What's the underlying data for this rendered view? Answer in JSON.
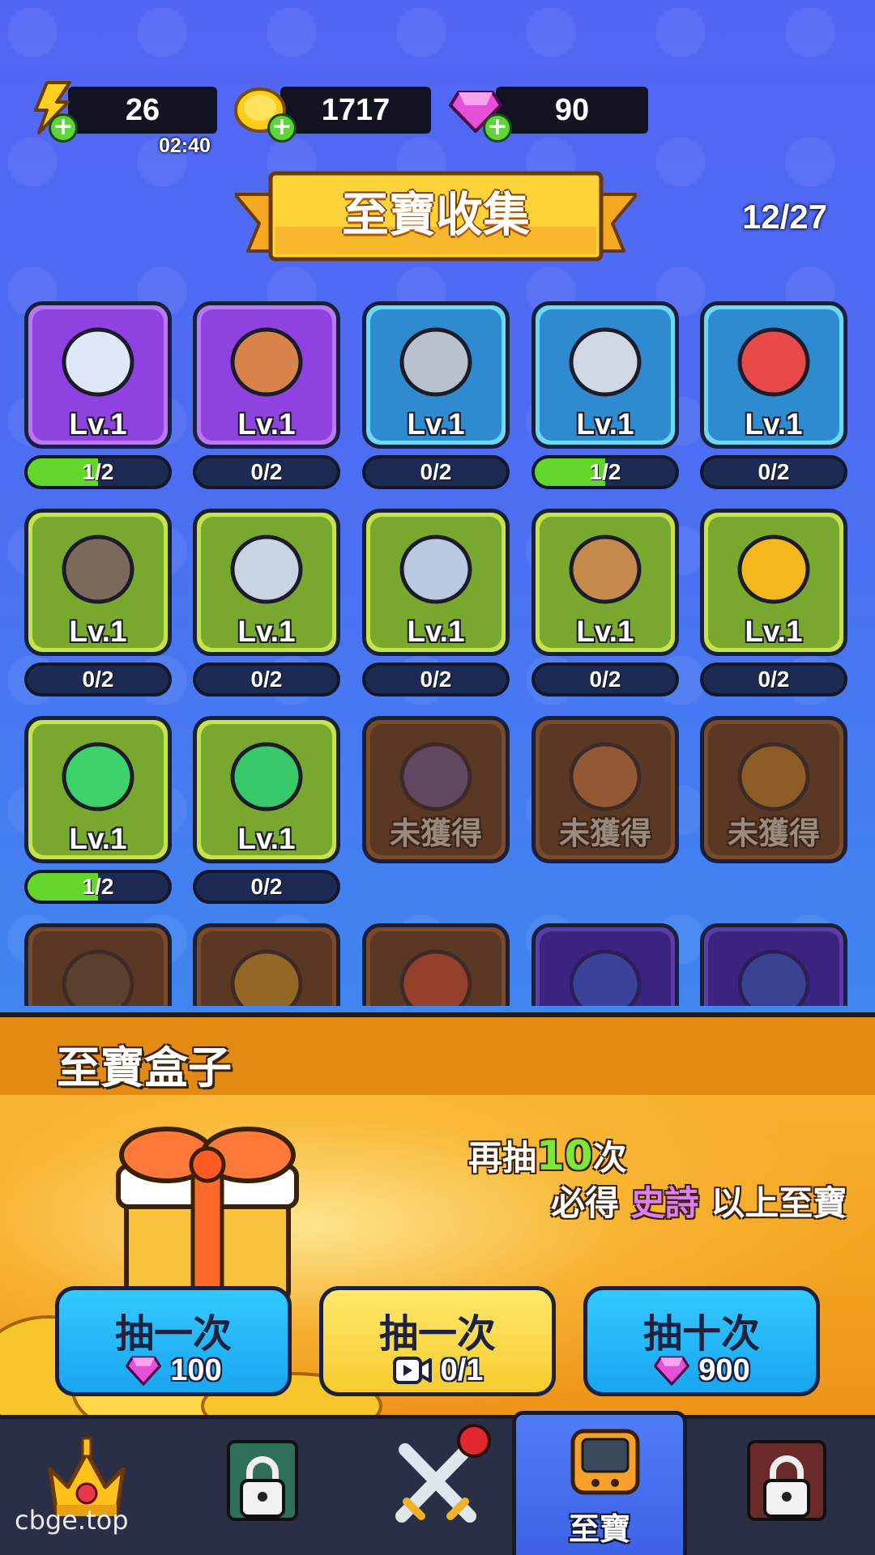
{
  "resources": {
    "energy": {
      "value": "26",
      "timer": "02:40",
      "icon": "lightning-icon"
    },
    "gold": {
      "value": "1717",
      "icon": "gold-coin-icon"
    },
    "gems": {
      "value": "90",
      "icon": "gem-icon"
    }
  },
  "header": {
    "title": "至寶收集",
    "collected": "12/27"
  },
  "treasures": [
    {
      "level": "Lv.1",
      "progress": "1/2",
      "fill": 0.5,
      "rarity": "purple",
      "icon": "boot-icon"
    },
    {
      "level": "Lv.1",
      "progress": "0/2",
      "fill": 0,
      "rarity": "purple",
      "icon": "scroll-icon"
    },
    {
      "level": "Lv.1",
      "progress": "0/2",
      "fill": 0,
      "rarity": "blue",
      "icon": "arrowhead-icon"
    },
    {
      "level": "Lv.1",
      "progress": "1/2",
      "fill": 0.5,
      "rarity": "blue",
      "icon": "dagger-icon"
    },
    {
      "level": "Lv.1",
      "progress": "0/2",
      "fill": 0,
      "rarity": "blue",
      "icon": "skull-icon"
    },
    {
      "level": "Lv.1",
      "progress": "0/2",
      "fill": 0,
      "rarity": "green",
      "icon": "drum-icon"
    },
    {
      "level": "Lv.1",
      "progress": "0/2",
      "fill": 0,
      "rarity": "green",
      "icon": "castle-icon"
    },
    {
      "level": "Lv.1",
      "progress": "0/2",
      "fill": 0,
      "rarity": "green",
      "icon": "shield-icon"
    },
    {
      "level": "Lv.1",
      "progress": "0/2",
      "fill": 0,
      "rarity": "green",
      "icon": "doghouse-icon"
    },
    {
      "level": "Lv.1",
      "progress": "0/2",
      "fill": 0,
      "rarity": "green",
      "icon": "horse-badge-icon"
    },
    {
      "level": "Lv.1",
      "progress": "1/2",
      "fill": 0.5,
      "rarity": "green",
      "icon": "bow-scroll-icon"
    },
    {
      "level": "Lv.1",
      "progress": "0/2",
      "fill": 0,
      "rarity": "green",
      "icon": "turtle-shell-icon"
    },
    {
      "locked": "未獲得",
      "rarity": "brown",
      "icon": "plus-coin-icon"
    },
    {
      "locked": "未獲得",
      "rarity": "brown",
      "icon": "slow-scroll-icon"
    },
    {
      "locked": "未獲得",
      "rarity": "brown",
      "icon": "sack-icon"
    },
    {
      "rarity": "brown",
      "icon": "tax-scroll-icon"
    },
    {
      "rarity": "brown",
      "icon": "gold-emblem-icon"
    },
    {
      "rarity": "brown",
      "icon": "boost-scroll-icon"
    },
    {
      "rarity": "dpurple",
      "icon": "save-shield-icon"
    },
    {
      "rarity": "dpurple",
      "icon": "flag-icon"
    }
  ],
  "box": {
    "title": "至寶盒子",
    "promo_line1_prefix": "再抽",
    "promo_count": "10",
    "promo_line1_suffix": "次",
    "promo_line2_prefix": "必得",
    "promo_rarity": "史詩",
    "promo_line2_suffix": "以上至寶",
    "buttons": [
      {
        "label": "抽一次",
        "cost": "100",
        "icon": "gem-icon"
      },
      {
        "label": "抽一次",
        "cost": "0/1",
        "icon": "video-icon"
      },
      {
        "label": "抽十次",
        "cost": "900",
        "icon": "gem-icon"
      }
    ]
  },
  "nav": {
    "items": [
      {
        "icon": "crown-icon"
      },
      {
        "icon": "lock-icon"
      },
      {
        "icon": "crossed-swords-icon"
      },
      {
        "icon": "treasure-device-icon",
        "label": "至寶"
      },
      {
        "icon": "lock-icon"
      }
    ]
  },
  "watermark": "cbge.top",
  "colors": {
    "progress_green": "#62d62b",
    "accent_yellow": "#ffd23a",
    "nav_active": "#4f7cf7"
  }
}
